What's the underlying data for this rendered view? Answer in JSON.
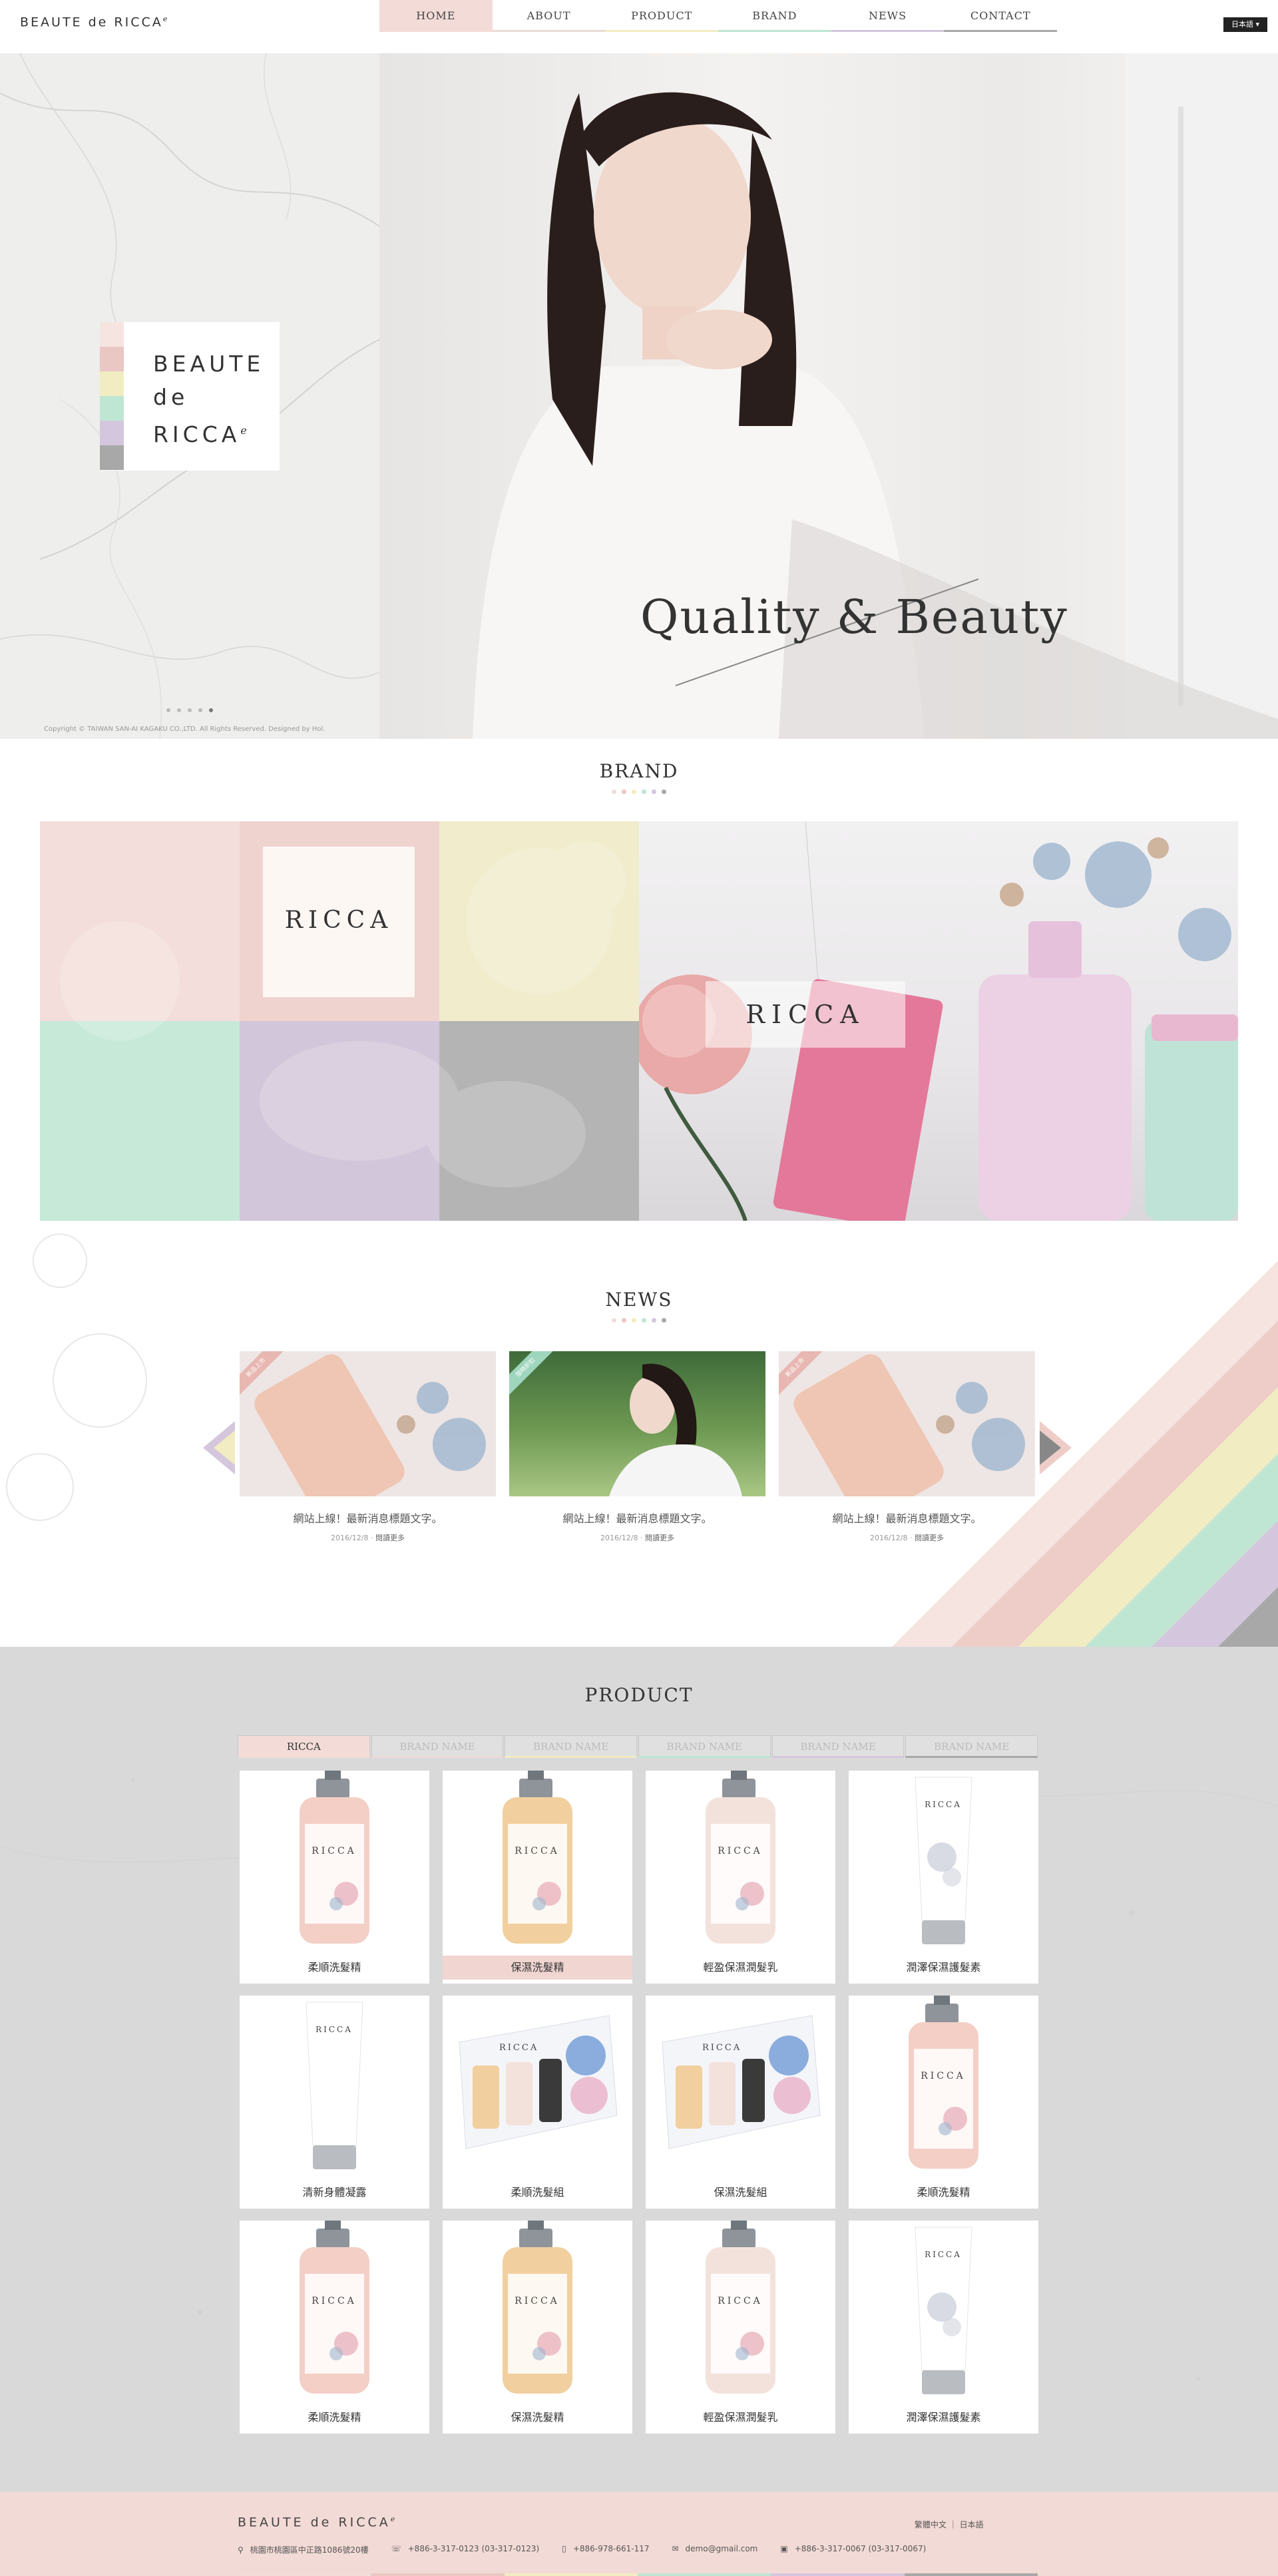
{
  "colors": {
    "pink": "#f3dcd8",
    "rose": "#eac7c3",
    "cream": "#f1ecc2",
    "mint": "#bfe6d3",
    "lavender": "#d4c6dd",
    "gray": "#a8a8a8",
    "dark": "#333333"
  },
  "header": {
    "logo": "BEAUTE de RICCA",
    "logo_mark": "ℯ",
    "nav": [
      {
        "label": "HOME"
      },
      {
        "label": "ABOUT"
      },
      {
        "label": "PRODUCT"
      },
      {
        "label": "BRAND"
      },
      {
        "label": "NEWS"
      },
      {
        "label": "CONTACT"
      }
    ],
    "language": "日本語 ▾"
  },
  "hero": {
    "brand_line1": "BEAUTE",
    "brand_line2": "de",
    "brand_line3": "RICCA",
    "tagline": "Quality & Beauty",
    "copyright": "Copyright © TAIWAN SAN-AI KAGAKU CO.,LTD. All Rights Reserved. Designed by Hol."
  },
  "brand_section": {
    "title": "BRAND",
    "card_label": "RICCA",
    "photo_label": "RICCA"
  },
  "news_section": {
    "title": "NEWS",
    "items": [
      {
        "badge": "新品上市",
        "title": "網站上線！最新消息標題文字。",
        "date": "2016/12/8",
        "more": "閱讀更多"
      },
      {
        "badge": "限時折扣",
        "title": "網站上線！最新消息標題文字。",
        "date": "2016/12/8",
        "more": "閱讀更多"
      },
      {
        "badge": "新品上市",
        "title": "網站上線！最新消息標題文字。",
        "date": "2016/12/8",
        "more": "閱讀更多"
      }
    ]
  },
  "product_section": {
    "title": "PRODUCT",
    "tabs": [
      "RICCA",
      "BRAND NAME",
      "BRAND NAME",
      "BRAND NAME",
      "BRAND NAME",
      "BRAND NAME"
    ],
    "products": [
      {
        "name": "柔順洗髮精",
        "kind": "bottle-pink"
      },
      {
        "name": "保濕洗髮精",
        "kind": "bottle-amber"
      },
      {
        "name": "輕盈保濕潤髮乳",
        "kind": "bottle-light"
      },
      {
        "name": "潤澤保濕護髮素",
        "kind": "tube"
      },
      {
        "name": "清新身體凝露",
        "kind": "tube-white"
      },
      {
        "name": "柔順洗髮組",
        "kind": "box"
      },
      {
        "name": "保濕洗髮組",
        "kind": "box"
      },
      {
        "name": "柔順洗髮精",
        "kind": "bottle-pink"
      },
      {
        "name": "柔順洗髮精",
        "kind": "bottle-pink"
      },
      {
        "name": "保濕洗髮精",
        "kind": "bottle-amber"
      },
      {
        "name": "輕盈保濕潤髮乳",
        "kind": "bottle-light"
      },
      {
        "name": "潤澤保濕護髮素",
        "kind": "tube"
      }
    ]
  },
  "footer": {
    "logo": "BEAUTE de RICCA",
    "lang_links": "繁體中文 ｜ 日本語",
    "address": "桃園市桃園區中正路1086號20樓",
    "phone": "+886-3-317-0123 (03-317-0123)",
    "mobile": "+886-978-661-117",
    "email": "demo@gmail.com",
    "fax": "+886-3-317-0067 (03-317-0067)"
  }
}
